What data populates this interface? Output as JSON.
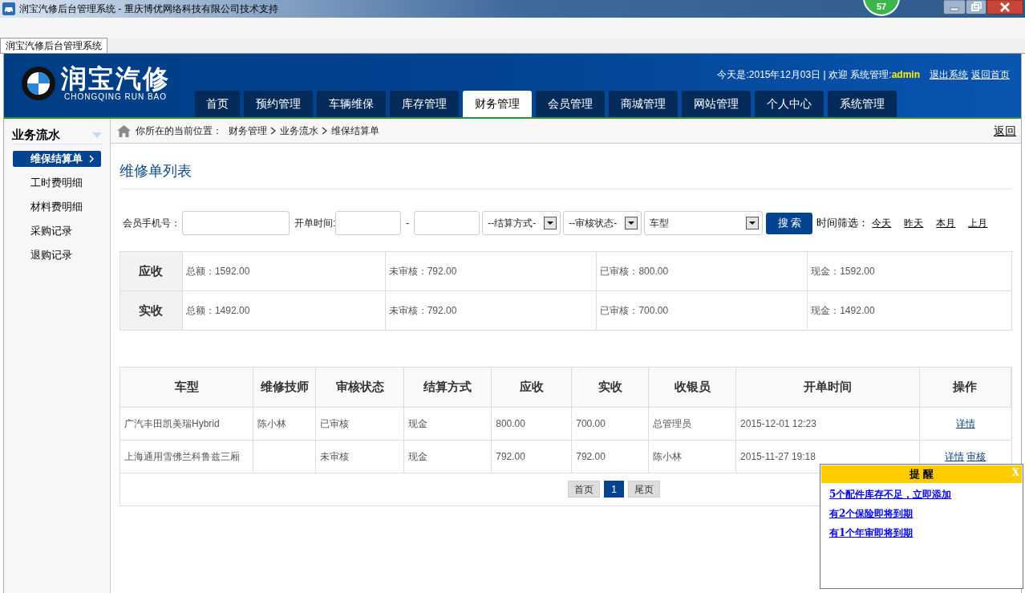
{
  "window": {
    "title": "润宝汽修后台管理系统 - 重庆博优网络科技有限公司技术支持",
    "badge": "57"
  },
  "browser_tab": {
    "label": "润宝汽修后台管理系统",
    "selected": true
  },
  "header": {
    "logo_title": "润宝汽修",
    "logo_subtitle": "CHONGQING RUN BAO",
    "info": "今天是:2015年12月03日 | 欢迎 系统管理:",
    "user": "admin",
    "links": [
      "退出系统",
      "返回首页"
    ]
  },
  "nav_tabs": [
    {
      "label": "首页",
      "selected": false
    },
    {
      "label": "预约管理",
      "selected": false
    },
    {
      "label": "车辆维保",
      "selected": false
    },
    {
      "label": "库存管理",
      "selected": false
    },
    {
      "label": "财务管理",
      "selected": true
    },
    {
      "label": "会员管理",
      "selected": false
    },
    {
      "label": "商城管理",
      "selected": false
    },
    {
      "label": "网站管理",
      "selected": false
    },
    {
      "label": "个人中心",
      "selected": false
    },
    {
      "label": "系统管理",
      "selected": false
    }
  ],
  "sidebar": {
    "title": "业务流水",
    "items": [
      {
        "label": "维保结算单",
        "selected": true
      },
      {
        "label": "工时费明细",
        "selected": false
      },
      {
        "label": "材料费明细",
        "selected": false
      },
      {
        "label": "采购记录",
        "selected": false
      },
      {
        "label": "退购记录",
        "selected": false
      }
    ]
  },
  "breadcrumb": {
    "label": "你所在的当前位置：",
    "path": [
      "财务管理",
      "业务流水",
      "维保结算单"
    ],
    "back": "返回"
  },
  "page_title": "维修单列表",
  "filters": {
    "phone_label": "会员手机号：",
    "time_label": "开单时间:",
    "separator": "-",
    "selects": [
      "--结算方式-",
      "--审核状态-",
      "车型"
    ],
    "search_button": "搜 索",
    "time_filter_label": "时间筛选：",
    "time_links": [
      "今天",
      "昨天",
      "本月",
      "上月"
    ]
  },
  "summary": [
    {
      "label": "应收",
      "cells": [
        "总额：1592.00",
        "未审核：792.00",
        "已审核：800.00",
        "现金：1592.00"
      ]
    },
    {
      "label": "实收",
      "cells": [
        "总额：1492.00",
        "未审核：792.00",
        "已审核：700.00",
        "现金：1492.00"
      ]
    }
  ],
  "table": {
    "columns": [
      "车型",
      "维修技师",
      "审核状态",
      "结算方式",
      "应收",
      "实收",
      "收银员",
      "开单时间",
      "操作"
    ],
    "rows": [
      {
        "cells": [
          "广汽丰田凯美瑞Hybrid",
          "陈小林",
          "已审核",
          "现金",
          "800.00",
          "700.00",
          "总管理员",
          "2015-12-01 12:23"
        ],
        "actions": [
          "详情"
        ]
      },
      {
        "cells": [
          "上海通用雪佛兰科鲁兹三厢",
          "",
          "未审核",
          "现金",
          "792.00",
          "792.00",
          "陈小林",
          "2015-11-27 19:18"
        ],
        "actions": [
          "详情",
          "审核"
        ]
      }
    ]
  },
  "pagination": {
    "first": "首页",
    "pages": [
      {
        "label": "1",
        "selected": true
      }
    ],
    "last": "尾页"
  },
  "reminder": {
    "title": "提 醒",
    "close": "X",
    "links": [
      "5个配件库存不足，立即添加",
      "有2个保险即将到期",
      "有1个年审即将到期"
    ]
  }
}
